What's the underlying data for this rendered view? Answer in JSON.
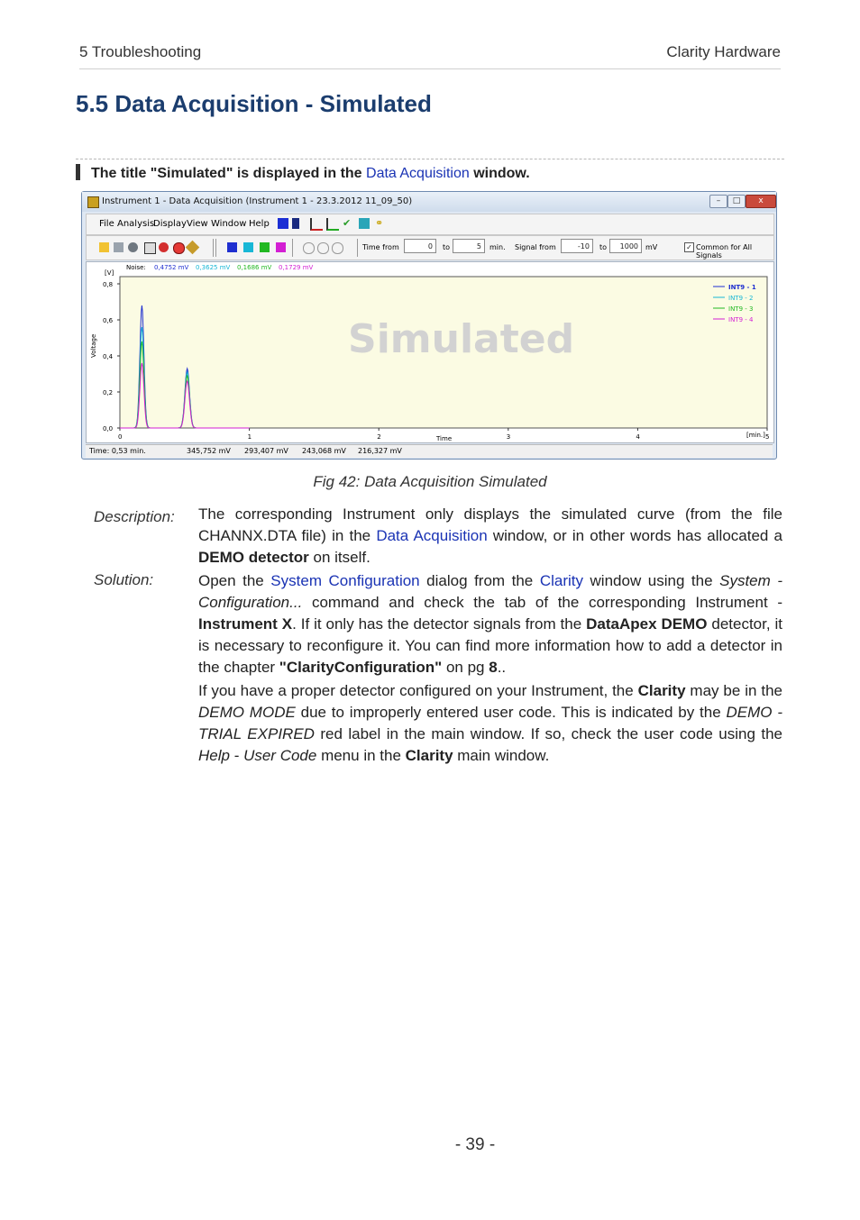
{
  "header": {
    "left": "5 Troubleshooting",
    "right": "Clarity Hardware"
  },
  "section_title": "5.5 Data Acquisition - Simulated",
  "caption_heading": {
    "before": "The title \"Simulated\" is displayed in the",
    "link": "Data Acquisition",
    "after": "window."
  },
  "app_window": {
    "title": "Instrument 1 - Data Acquisition (Instrument 1 - 23.3.2012 11_09_50)",
    "buttons": {
      "minimize": "–",
      "maximize": "□",
      "close": "x"
    },
    "menu": [
      "File",
      "Analysis",
      "Display",
      "View",
      "Window",
      "Help"
    ],
    "toolbar": {
      "time_from_label": "Time from",
      "time_from_value": "0",
      "to_label": "to",
      "time_to_value": "5",
      "time_unit": "min.",
      "signal_from_label": "Signal from",
      "signal_from_value": "-10",
      "signal_to_label": "to",
      "signal_to_value": "1000",
      "signal_unit": "mV",
      "common_label": "Common for All Signals",
      "common_checked": "✓"
    },
    "plot": {
      "watermark": "Simulated",
      "noise_label": "Noise:",
      "noise": [
        {
          "value": "0,4752 mV",
          "color": "#1f2fd0"
        },
        {
          "value": "0,3625 mV",
          "color": "#18b7d6"
        },
        {
          "value": "0,1686 mV",
          "color": "#22b822"
        },
        {
          "value": "0,1729 mV",
          "color": "#d31fd3"
        }
      ],
      "legend": [
        {
          "name": "INT9 - 1",
          "color": "#1f2fd0"
        },
        {
          "name": "INT9 - 2",
          "color": "#18b7d6"
        },
        {
          "name": "INT9 - 3",
          "color": "#22b822"
        },
        {
          "name": "INT9 - 4",
          "color": "#d31fd3"
        }
      ],
      "y_unit": "[V]",
      "y_axis_label": "Voltage",
      "y_ticks": [
        "0,0",
        "0,2",
        "0,4",
        "0,6",
        "0,8"
      ],
      "x_axis_label": "Time",
      "x_unit": "[min.]",
      "x_ticks": [
        "0",
        "1",
        "2",
        "3",
        "4",
        "5"
      ],
      "bg_color": "#fbfbe3"
    },
    "status": {
      "time": "Time: 0,53 min.",
      "v1": "345,752 mV",
      "v2": "293,407 mV",
      "v3": "243,068 mV",
      "v4": "216,327 mV"
    }
  },
  "figure_caption": "Fig 42: Data Acquisition Simulated",
  "description": {
    "label": "Description:",
    "t1": "The corresponding Instrument only displays the simulated curve (from the file CHANNX.DTA file) in the ",
    "link": "Data Acquisition",
    "t2": " window, or in other words has allocated a ",
    "bold": "DEMO detector",
    "t3": " on itself."
  },
  "solution": {
    "label": "Solution:",
    "p1": {
      "t1": "Open the ",
      "link1": "System Configuration",
      "t2": " dialog from the ",
      "link2": "Clarity",
      "t3": " window using the ",
      "i1": "System - Configuration...",
      "t4": " command and check the tab of the corresponding Instrument - ",
      "b1": "Instrument X",
      "t5": ". If it only has the detector signals from the ",
      "b2": "DataApex DEMO",
      "t6": " detector, it is necessary to reconfigure it. You can find more information how to add a detector in the chapter ",
      "b3": "\"ClarityConfiguration\"",
      "t7": " on pg ",
      "b4": "8",
      "t8": ".."
    },
    "p2": {
      "t1": "If you have a proper detector configured on your Instrument, the ",
      "b1": "Clarity",
      "t2": " may be in the ",
      "i1": "DEMO MODE",
      "t3": " due to improperly entered user code. This is indicated by the ",
      "i2": "DEMO - TRIAL EXPIRED",
      "t4": " red label in the main window. If so, check the user code using the ",
      "i3": "Help",
      "t5": " - ",
      "i4": "User Code",
      "t6": " menu in the ",
      "b2": "Clarity",
      "t7": " main window."
    }
  },
  "page_number": "- 39 -"
}
